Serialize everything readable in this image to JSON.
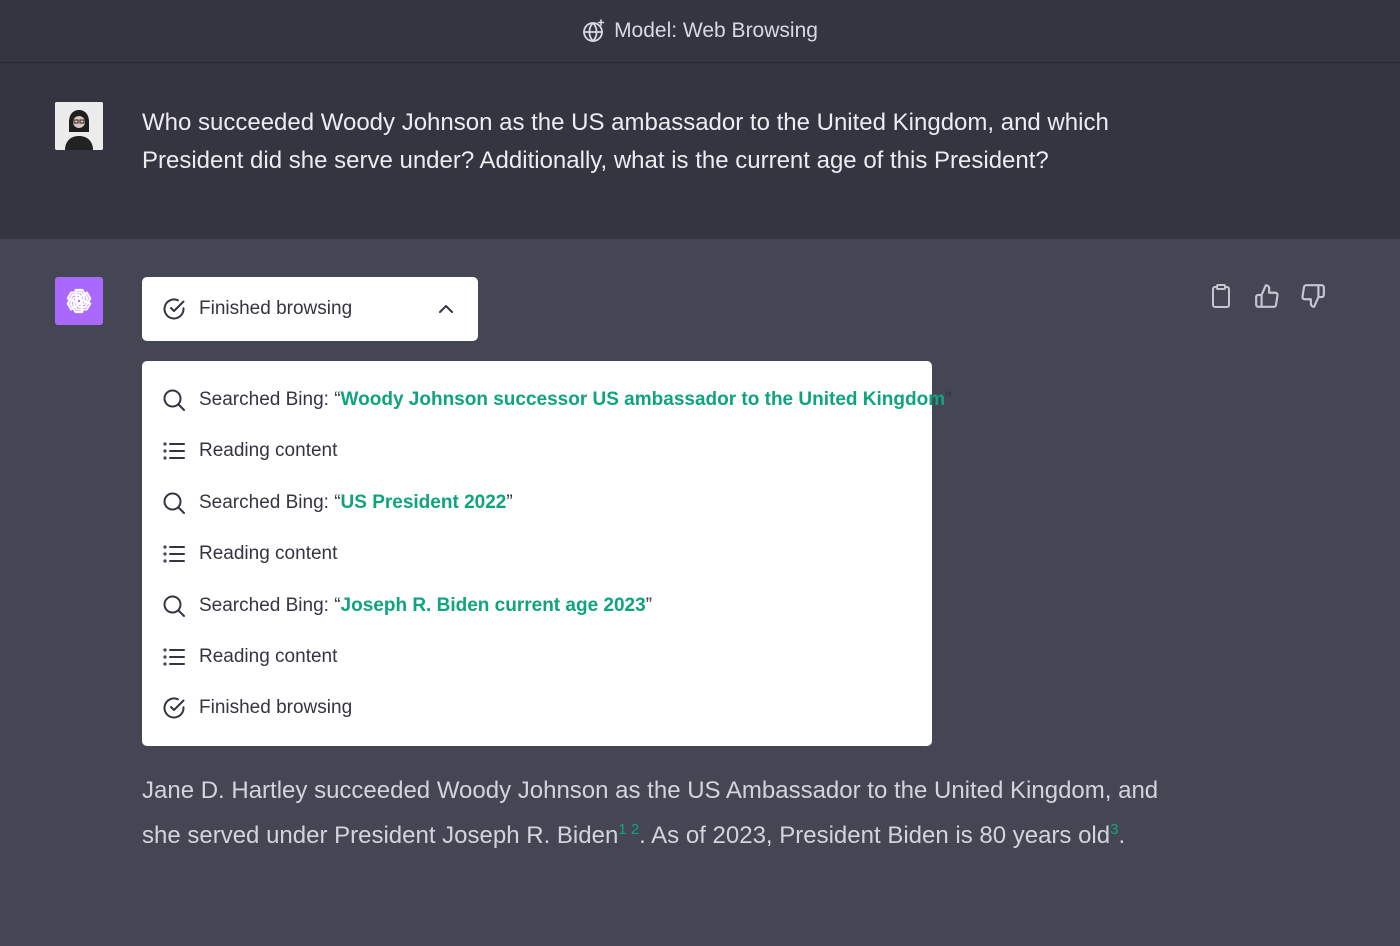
{
  "header": {
    "title": "Model: Web Browsing",
    "icon": "globe-sparkle-icon"
  },
  "user_message": {
    "text": "Who succeeded Woody Johnson as the US ambassador to the United Kingdom, and which President did she serve under? Additionally, what is the current age of this President?"
  },
  "browsing": {
    "toggle_label": "Finished browsing",
    "steps": [
      {
        "icon": "search-icon",
        "prefix": "Searched Bing: “",
        "query": "Woody Johnson successor US ambassador to the United Kingdom",
        "suffix": "”"
      },
      {
        "icon": "list-icon",
        "label": "Reading content"
      },
      {
        "icon": "search-icon",
        "prefix": "Searched Bing: “",
        "query": "US President 2022",
        "suffix": "”"
      },
      {
        "icon": "list-icon",
        "label": "Reading content"
      },
      {
        "icon": "search-icon",
        "prefix": "Searched Bing: “",
        "query": "Joseph R. Biden current age 2023",
        "suffix": "”"
      },
      {
        "icon": "list-icon",
        "label": "Reading content"
      },
      {
        "icon": "check-circle-icon",
        "label": "Finished browsing"
      }
    ]
  },
  "answer": {
    "part1": "Jane D. Hartley succeeded Woody Johnson as the US Ambassador to the United Kingdom, and she served under President Joseph R. Biden",
    "cite1": "1",
    "cite2": "2",
    "part2": ". As of 2023, President Biden is 80 years old",
    "cite3": "3",
    "part3": "."
  },
  "colors": {
    "accent": "#10a37f",
    "gpt_avatar": "#ab68ff",
    "user_bg": "#343541",
    "assistant_bg": "#444654"
  }
}
